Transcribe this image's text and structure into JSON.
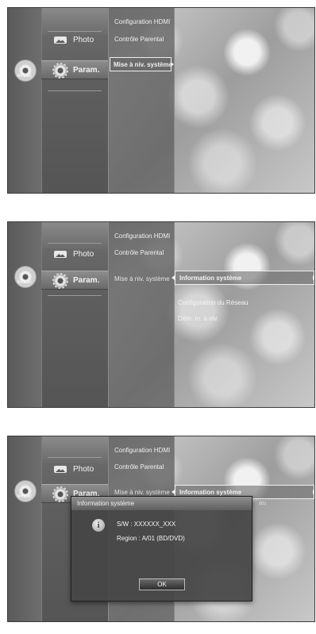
{
  "left_panel": {
    "disc_status": "No Disc"
  },
  "main_menu": {
    "photo": "Photo",
    "settings": "Param."
  },
  "settings_menu": {
    "hdmi": "Configuration HDMI",
    "parental": "Contrôle Parental",
    "system_upgrade": "Mise à niv. système"
  },
  "upgrade_menu": {
    "system_info": "Information système",
    "network_config": "Configuration du Réseau",
    "network_start": "Dém. m. à niv.",
    "network_config_partial": "au"
  },
  "dialog": {
    "title": "Information système",
    "icon": "info-icon",
    "sw_line": "S/W : XXXXXX_XXX",
    "region_line": "Region : A/01 (BD/DVD)",
    "ok_label": "OK"
  },
  "colors": {
    "panel_dark": "#5e5e5e",
    "text_light": "#f4f4f4",
    "highlight_border": "#f0f0f0"
  }
}
